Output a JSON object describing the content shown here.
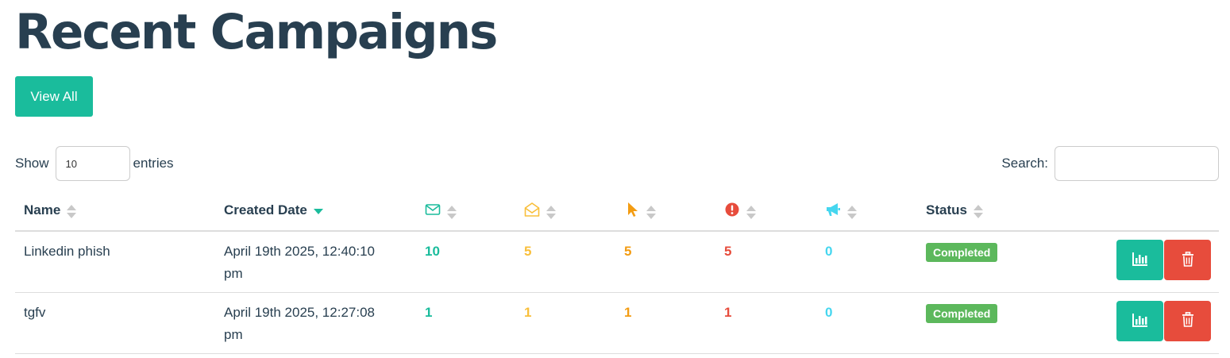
{
  "header": {
    "title": "Recent Campaigns",
    "view_all_label": "View All"
  },
  "table_controls": {
    "show_label": "Show",
    "entries_value": "10",
    "entries_label": "entries",
    "search_label": "Search:",
    "search_value": ""
  },
  "columns": {
    "name": "Name",
    "created_date": "Created Date",
    "sent_icon": "envelope-icon",
    "opened_icon": "envelope-open-icon",
    "clicked_icon": "mouse-pointer-icon",
    "error_icon": "exclamation-circle-icon",
    "reported_icon": "bullhorn-icon",
    "status": "Status"
  },
  "rows": [
    {
      "name": "Linkedin phish",
      "created_line1": "April 19th 2025, 12:40:10",
      "created_line2": "pm",
      "sent": "10",
      "opened": "5",
      "clicked": "5",
      "errors": "5",
      "reported": "0",
      "status": "Completed"
    },
    {
      "name": "tgfv",
      "created_line1": "April 19th 2025, 12:27:08",
      "created_line2": "pm",
      "sent": "1",
      "opened": "1",
      "clicked": "1",
      "errors": "1",
      "reported": "0",
      "status": "Completed"
    }
  ],
  "colors": {
    "primary": "#1abc9c",
    "danger": "#e74c3c",
    "heading": "#283f50",
    "opened": "#f9bf3b",
    "clicked": "#f39c12",
    "reported": "#45d6ef",
    "completed": "#5cb85c"
  }
}
